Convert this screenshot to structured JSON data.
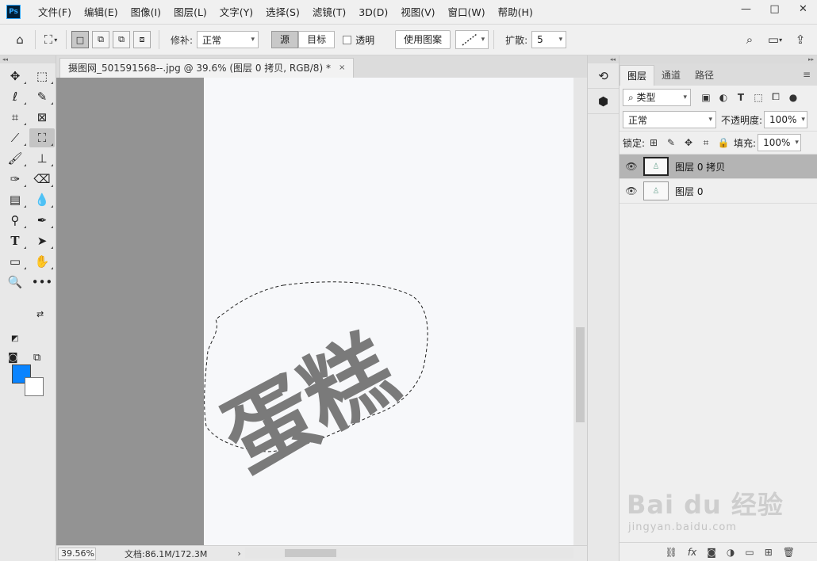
{
  "app": {
    "logo": "Ps",
    "menu": [
      "文件(F)",
      "编辑(E)",
      "图像(I)",
      "图层(L)",
      "文字(Y)",
      "选择(S)",
      "滤镜(T)",
      "3D(D)",
      "视图(V)",
      "窗口(W)",
      "帮助(H)"
    ],
    "window_controls": {
      "minimize": "—",
      "restore": "□",
      "close": "✕"
    }
  },
  "options": {
    "patch_label": "修补:",
    "patch_value": "正常",
    "source_label": "源",
    "target_label": "目标",
    "transparent_label": "透明",
    "use_pattern_label": "使用图案",
    "diffuse_label": "扩散:",
    "diffuse_value": "5"
  },
  "document": {
    "tab_title": "摄图网_501591568--.jpg @ 39.6% (图层 0 拷贝, RGB/8) *",
    "tab_close": "×",
    "canvas_text": "蛋糕",
    "zoom": "39.56%",
    "doc_info": "文档:86.1M/172.3M",
    "status_arrow": "›"
  },
  "colors": {
    "foreground": "#0a84ff",
    "background": "#ffffff",
    "canvas_text": "#7a7a7a"
  },
  "layers_panel": {
    "tabs": [
      "图层",
      "通道",
      "路径"
    ],
    "filter_label": "类型",
    "blend_mode": "正常",
    "opacity_label": "不透明度:",
    "opacity_value": "100%",
    "lock_label": "锁定:",
    "fill_label": "填充:",
    "fill_value": "100%",
    "layers": [
      {
        "name": "图层 0 拷贝",
        "selected": true
      },
      {
        "name": "图层 0",
        "selected": false
      }
    ]
  },
  "watermark": {
    "text": "Bai du 经验",
    "sub": "jingyan.baidu.com"
  }
}
